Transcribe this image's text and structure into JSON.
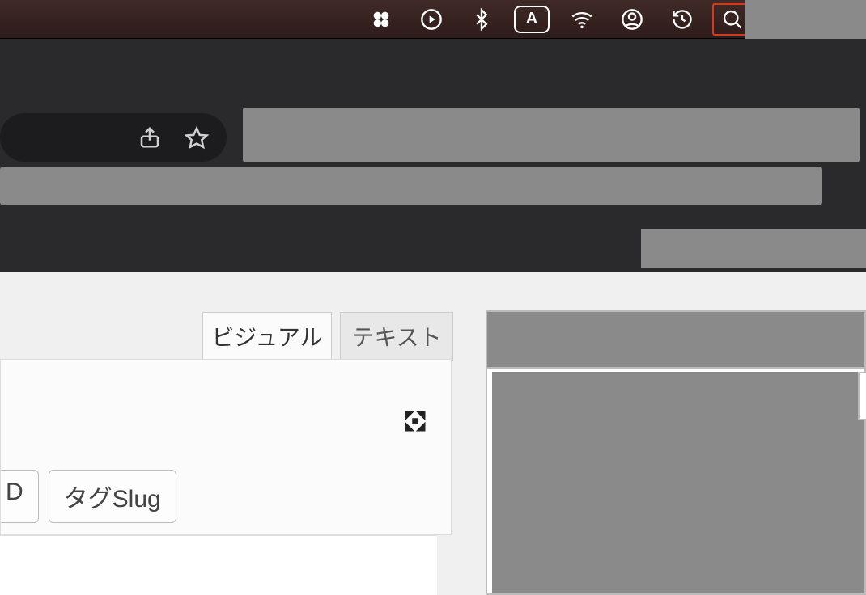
{
  "menubar": {
    "input_indicator": "A"
  },
  "editor": {
    "tabs": {
      "visual": "ビジュアル",
      "text": "テキスト"
    },
    "buttons": {
      "partial_d": "D",
      "tag_slug": "タグSlug"
    }
  }
}
